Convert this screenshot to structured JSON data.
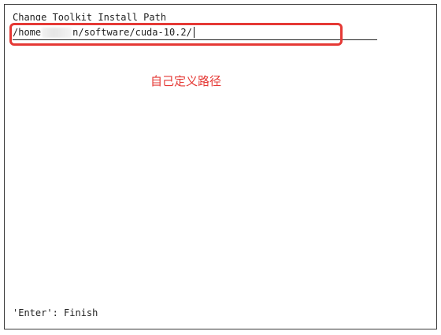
{
  "dialog": {
    "title": "Change Toolkit Install Path",
    "path_prefix": "/home",
    "path_suffix": "n/software/cuda-10.2/"
  },
  "annotation": {
    "text": "自己定义路径",
    "color": "#e53935"
  },
  "footer": {
    "hint": "'Enter': Finish"
  }
}
